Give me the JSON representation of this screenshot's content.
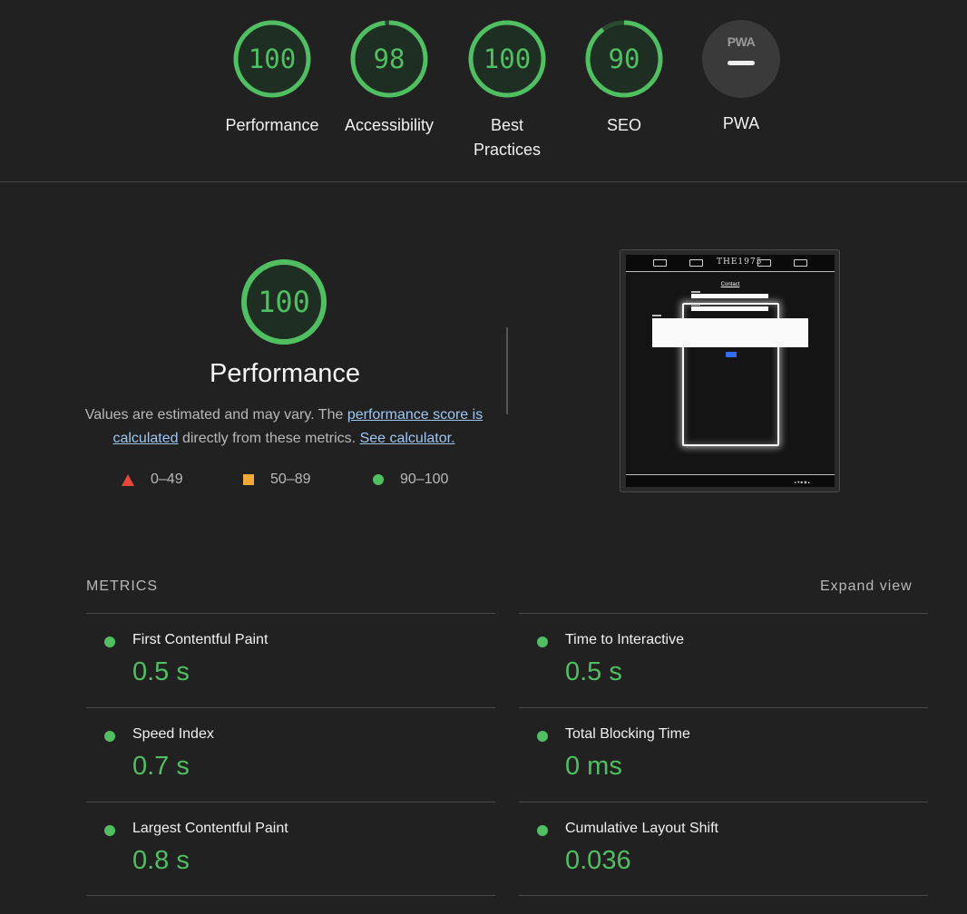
{
  "gauges": [
    {
      "score": "100",
      "label": "Performance",
      "fraction": 1.0
    },
    {
      "score": "98",
      "label": "Accessibility",
      "fraction": 0.98
    },
    {
      "score": "100",
      "label": "Best Practices",
      "fraction": 1.0
    },
    {
      "score": "90",
      "label": "SEO",
      "fraction": 0.9
    }
  ],
  "pwa": {
    "badge": "PWA",
    "label": "PWA"
  },
  "performance": {
    "score": "100",
    "fraction": 1.0,
    "title": "Performance",
    "desc_prefix": "Values are estimated and may vary. The ",
    "score_link": "performance score is calculated",
    "desc_middle": " directly from these metrics. ",
    "calc_link": "See calculator."
  },
  "legend": {
    "fail": "0–49",
    "average": "50–89",
    "pass": "90–100"
  },
  "thumbnail": {
    "logo": "THE1975",
    "title": "Contact"
  },
  "metrics": {
    "heading": "METRICS",
    "expand_label": "Expand view",
    "items": [
      {
        "title": "First Contentful Paint",
        "value": "0.5 s"
      },
      {
        "title": "Time to Interactive",
        "value": "0.5 s"
      },
      {
        "title": "Speed Index",
        "value": "0.7 s"
      },
      {
        "title": "Total Blocking Time",
        "value": "0 ms"
      },
      {
        "title": "Largest Contentful Paint",
        "value": "0.8 s"
      },
      {
        "title": "Cumulative Layout Shift",
        "value": "0.036"
      }
    ]
  },
  "colors": {
    "pass": "#4fbf62",
    "average": "#f3a93a",
    "fail": "#e5483a",
    "background": "#212121"
  }
}
